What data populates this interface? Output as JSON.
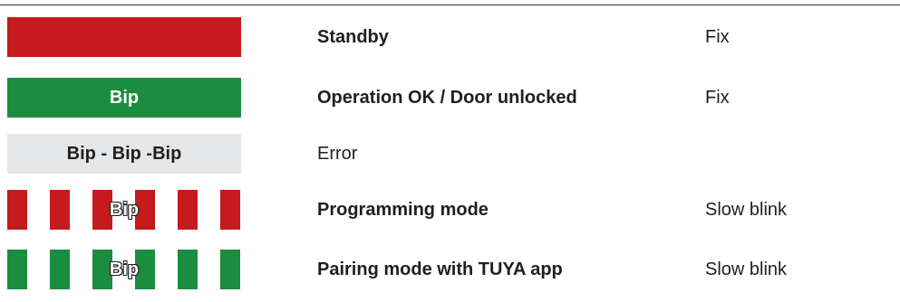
{
  "colors": {
    "red": "#c51a1e",
    "green": "#1b8d3e",
    "grey": "#e5e6e8"
  },
  "rows": [
    {
      "indicator": "red-solid",
      "sound": "",
      "status": "Standby",
      "mode": "Fix"
    },
    {
      "indicator": "green-solid",
      "sound": "Bip",
      "status": "Operation OK / Door unlocked",
      "mode": "Fix"
    },
    {
      "indicator": "grey-solid",
      "sound": "Bip - Bip -Bip",
      "status": "Error",
      "mode": ""
    },
    {
      "indicator": "red-stripes",
      "sound": "Bip",
      "status": "Programming mode",
      "mode": "Slow blink"
    },
    {
      "indicator": "green-stripes",
      "sound": "Bip",
      "status": "Pairing mode with TUYA app",
      "mode": "Slow blink"
    }
  ]
}
